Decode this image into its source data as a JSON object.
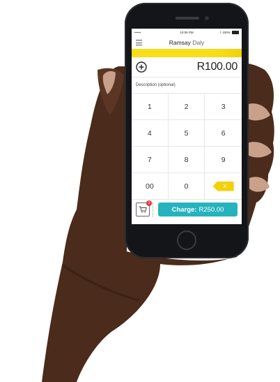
{
  "status_bar": {
    "carrier": "•••••",
    "wifi_icon": "wifi-icon",
    "time": "10:05 PM",
    "bluetooth_icon": "bluetooth-icon",
    "battery": "100%"
  },
  "header": {
    "menu_icon": "hamburger-menu-icon",
    "user_first": "Ramsay",
    "user_last": "Daly"
  },
  "amount": {
    "add_icon": "plus-circle-icon",
    "value": "R100.00"
  },
  "description": {
    "placeholder": "Description (optional)"
  },
  "keypad": {
    "keys": [
      "1",
      "2",
      "3",
      "4",
      "5",
      "6",
      "7",
      "8",
      "9",
      "00",
      "0"
    ],
    "backspace_label": "X"
  },
  "footer": {
    "cart_badge": "2",
    "charge_label": "Charge:",
    "charge_amount": "R250.00"
  },
  "colors": {
    "accent_yellow": "#f7de16",
    "charge_teal": "#26b3bd",
    "badge_red": "#d9393d"
  }
}
